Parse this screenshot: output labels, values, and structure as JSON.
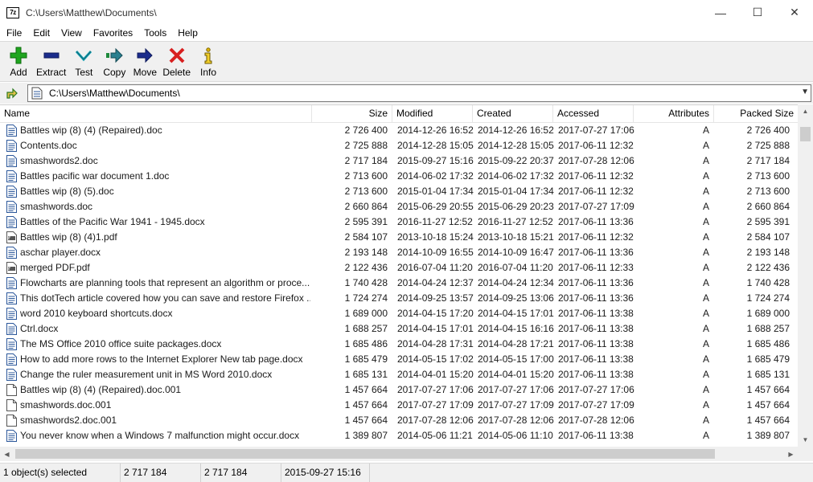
{
  "window": {
    "app_icon_text": "7z",
    "title": "C:\\Users\\Matthew\\Documents\\",
    "minimize": "—",
    "maximize": "☐",
    "close": "✕"
  },
  "menu": [
    "File",
    "Edit",
    "View",
    "Favorites",
    "Tools",
    "Help"
  ],
  "toolbar": [
    {
      "label": "Add",
      "icon": "add-icon"
    },
    {
      "label": "Extract",
      "icon": "extract-icon"
    },
    {
      "label": "Test",
      "icon": "test-icon"
    },
    {
      "label": "Copy",
      "icon": "copy-icon"
    },
    {
      "label": "Move",
      "icon": "move-icon"
    },
    {
      "label": "Delete",
      "icon": "delete-icon"
    },
    {
      "label": "Info",
      "icon": "info-icon"
    }
  ],
  "address": {
    "path": "C:\\Users\\Matthew\\Documents\\"
  },
  "columns": {
    "name": "Name",
    "size": "Size",
    "modified": "Modified",
    "created": "Created",
    "accessed": "Accessed",
    "attributes": "Attributes",
    "packed_size": "Packed Size"
  },
  "files": [
    {
      "name": "Battles wip (8) (4) (Repaired).doc",
      "icon": "word-doc-icon",
      "size": "2 726 400",
      "modified": "2014-12-26 16:52",
      "created": "2014-12-26 16:52",
      "accessed": "2017-07-27 17:06",
      "attr": "A",
      "packed": "2 726 400"
    },
    {
      "name": "Contents.doc",
      "icon": "word-doc-icon",
      "size": "2 725 888",
      "modified": "2014-12-28 15:05",
      "created": "2014-12-28 15:05",
      "accessed": "2017-06-11 12:32",
      "attr": "A",
      "packed": "2 725 888"
    },
    {
      "name": "smashwords2.doc",
      "icon": "word-doc-icon",
      "size": "2 717 184",
      "modified": "2015-09-27 15:16",
      "created": "2015-09-22 20:37",
      "accessed": "2017-07-28 12:06",
      "attr": "A",
      "packed": "2 717 184"
    },
    {
      "name": "Battles pacific war document 1.doc",
      "icon": "word-doc-icon",
      "size": "2 713 600",
      "modified": "2014-06-02 17:32",
      "created": "2014-06-02 17:32",
      "accessed": "2017-06-11 12:32",
      "attr": "A",
      "packed": "2 713 600"
    },
    {
      "name": "Battles wip (8) (5).doc",
      "icon": "word-doc-icon",
      "size": "2 713 600",
      "modified": "2015-01-04 17:34",
      "created": "2015-01-04 17:34",
      "accessed": "2017-06-11 12:32",
      "attr": "A",
      "packed": "2 713 600"
    },
    {
      "name": "smashwords.doc",
      "icon": "word-doc-icon",
      "size": "2 660 864",
      "modified": "2015-06-29 20:55",
      "created": "2015-06-29 20:23",
      "accessed": "2017-07-27 17:09",
      "attr": "A",
      "packed": "2 660 864"
    },
    {
      "name": "Battles of the Pacific War 1941 - 1945.docx",
      "icon": "word-doc-icon",
      "size": "2 595 391",
      "modified": "2016-11-27 12:52",
      "created": "2016-11-27 12:52",
      "accessed": "2017-06-11 13:36",
      "attr": "A",
      "packed": "2 595 391"
    },
    {
      "name": "Battles wip (8) (4)1.pdf",
      "icon": "pdf-icon",
      "size": "2 584 107",
      "modified": "2013-10-18 15:24",
      "created": "2013-10-18 15:21",
      "accessed": "2017-06-11 12:32",
      "attr": "A",
      "packed": "2 584 107"
    },
    {
      "name": "aschar player.docx",
      "icon": "word-doc-icon",
      "size": "2 193 148",
      "modified": "2014-10-09 16:55",
      "created": "2014-10-09 16:47",
      "accessed": "2017-06-11 13:36",
      "attr": "A",
      "packed": "2 193 148"
    },
    {
      "name": "merged PDF.pdf",
      "icon": "pdf-icon",
      "size": "2 122 436",
      "modified": "2016-07-04 11:20",
      "created": "2016-07-04 11:20",
      "accessed": "2017-06-11 12:33",
      "attr": "A",
      "packed": "2 122 436"
    },
    {
      "name": "Flowcharts are planning tools that represent an algorithm or proce...",
      "icon": "word-doc-icon",
      "size": "1 740 428",
      "modified": "2014-04-24 12:37",
      "created": "2014-04-24 12:34",
      "accessed": "2017-06-11 13:36",
      "attr": "A",
      "packed": "1 740 428"
    },
    {
      "name": "This dotTech article covered how you can save and restore Firefox ...",
      "icon": "word-doc-icon",
      "size": "1 724 274",
      "modified": "2014-09-25 13:57",
      "created": "2014-09-25 13:06",
      "accessed": "2017-06-11 13:36",
      "attr": "A",
      "packed": "1 724 274"
    },
    {
      "name": "word 2010 keyboard shortcuts.docx",
      "icon": "word-doc-icon",
      "size": "1 689 000",
      "modified": "2014-04-15 17:20",
      "created": "2014-04-15 17:01",
      "accessed": "2017-06-11 13:38",
      "attr": "A",
      "packed": "1 689 000"
    },
    {
      "name": "Ctrl.docx",
      "icon": "word-doc-icon",
      "size": "1 688 257",
      "modified": "2014-04-15 17:01",
      "created": "2014-04-15 16:16",
      "accessed": "2017-06-11 13:38",
      "attr": "A",
      "packed": "1 688 257"
    },
    {
      "name": "The MS Office 2010 office suite packages.docx",
      "icon": "word-doc-icon",
      "size": "1 685 486",
      "modified": "2014-04-28 17:31",
      "created": "2014-04-28 17:21",
      "accessed": "2017-06-11 13:38",
      "attr": "A",
      "packed": "1 685 486"
    },
    {
      "name": "How to add more rows to the Internet Explorer New tab page.docx",
      "icon": "word-doc-icon",
      "size": "1 685 479",
      "modified": "2014-05-15 17:02",
      "created": "2014-05-15 17:00",
      "accessed": "2017-06-11 13:38",
      "attr": "A",
      "packed": "1 685 479"
    },
    {
      "name": "Change the ruler measurement unit in MS Word 2010.docx",
      "icon": "word-doc-icon",
      "size": "1 685 131",
      "modified": "2014-04-01 15:20",
      "created": "2014-04-01 15:20",
      "accessed": "2017-06-11 13:38",
      "attr": "A",
      "packed": "1 685 131"
    },
    {
      "name": "Battles wip (8) (4) (Repaired).doc.001",
      "icon": "blank-file-icon",
      "size": "1 457 664",
      "modified": "2017-07-27 17:06",
      "created": "2017-07-27 17:06",
      "accessed": "2017-07-27 17:06",
      "attr": "A",
      "packed": "1 457 664"
    },
    {
      "name": "smashwords.doc.001",
      "icon": "blank-file-icon",
      "size": "1 457 664",
      "modified": "2017-07-27 17:09",
      "created": "2017-07-27 17:09",
      "accessed": "2017-07-27 17:09",
      "attr": "A",
      "packed": "1 457 664"
    },
    {
      "name": "smashwords2.doc.001",
      "icon": "blank-file-icon",
      "size": "1 457 664",
      "modified": "2017-07-28 12:06",
      "created": "2017-07-28 12:06",
      "accessed": "2017-07-28 12:06",
      "attr": "A",
      "packed": "1 457 664"
    },
    {
      "name": "You never know when a Windows 7 malfunction might occur.docx",
      "icon": "word-doc-icon",
      "size": "1 389 807",
      "modified": "2014-05-06 11:21",
      "created": "2014-05-06 11:10",
      "accessed": "2017-06-11 13:38",
      "attr": "A",
      "packed": "1 389 807"
    }
  ],
  "status": {
    "selection": "1 object(s) selected",
    "size": "2 717 184",
    "packed": "2 717 184",
    "modified": "2015-09-27 15:16"
  },
  "colors": {
    "toolbar_bg": "#f0f0f0",
    "word_icon_blue": "#2b579a",
    "add_green": "#1fa51f",
    "delete_red": "#d81f1f",
    "move_navy": "#1b2c8c"
  }
}
